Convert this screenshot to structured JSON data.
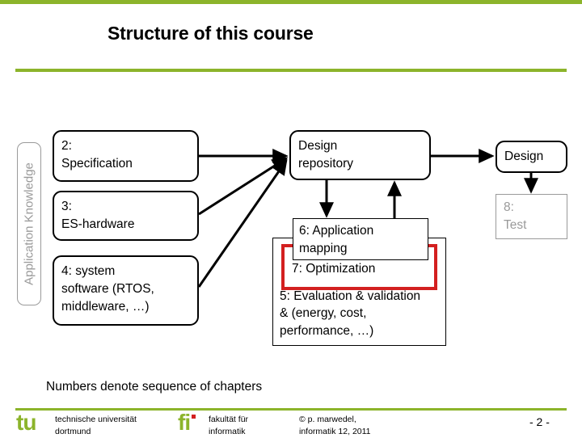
{
  "slide": {
    "title": "Structure of this course",
    "accent_color": "#8CB42B",
    "highlight_color": "#D32020",
    "muted_color": "#9A9A9A"
  },
  "side_label": {
    "text": "Application Knowledge"
  },
  "left_column": [
    {
      "id": "specification",
      "text": "2:\nSpecification",
      "line1": "2:",
      "line2": "Specification"
    },
    {
      "id": "es-hardware",
      "text": "3:\nES-hardware",
      "line1": "3:",
      "line2": "ES-hardware"
    },
    {
      "id": "system-software",
      "line1": "4: system",
      "line2": "software (RTOS,",
      "line3": "middleware, …)"
    }
  ],
  "middle_column": {
    "design_repository": {
      "line1": "Design",
      "line2": "repository"
    },
    "application_mapping": {
      "line1": "6: Application",
      "line2": "mapping"
    },
    "optimization": {
      "label": "7: Optimization"
    },
    "evaluation": {
      "line1": "5: Evaluation & validation",
      "line2": "& (energy, cost,",
      "line3": "performance, …)"
    }
  },
  "right_column": {
    "design": {
      "label": "Design"
    },
    "test": {
      "line1": "8:",
      "line2": "Test"
    }
  },
  "caption": {
    "text": "Numbers denote sequence of chapters"
  },
  "footer": {
    "logo_tu": "tu",
    "logo_fi": "fi",
    "tu_line1": "technische universität",
    "tu_line2": "dortmund",
    "fi_line1": "fakultät für",
    "fi_line2": "informatik",
    "copyright_line1": "© p. marwedel,",
    "copyright_line2": "informatik 12,  2011",
    "page_number": "-  2 -"
  }
}
